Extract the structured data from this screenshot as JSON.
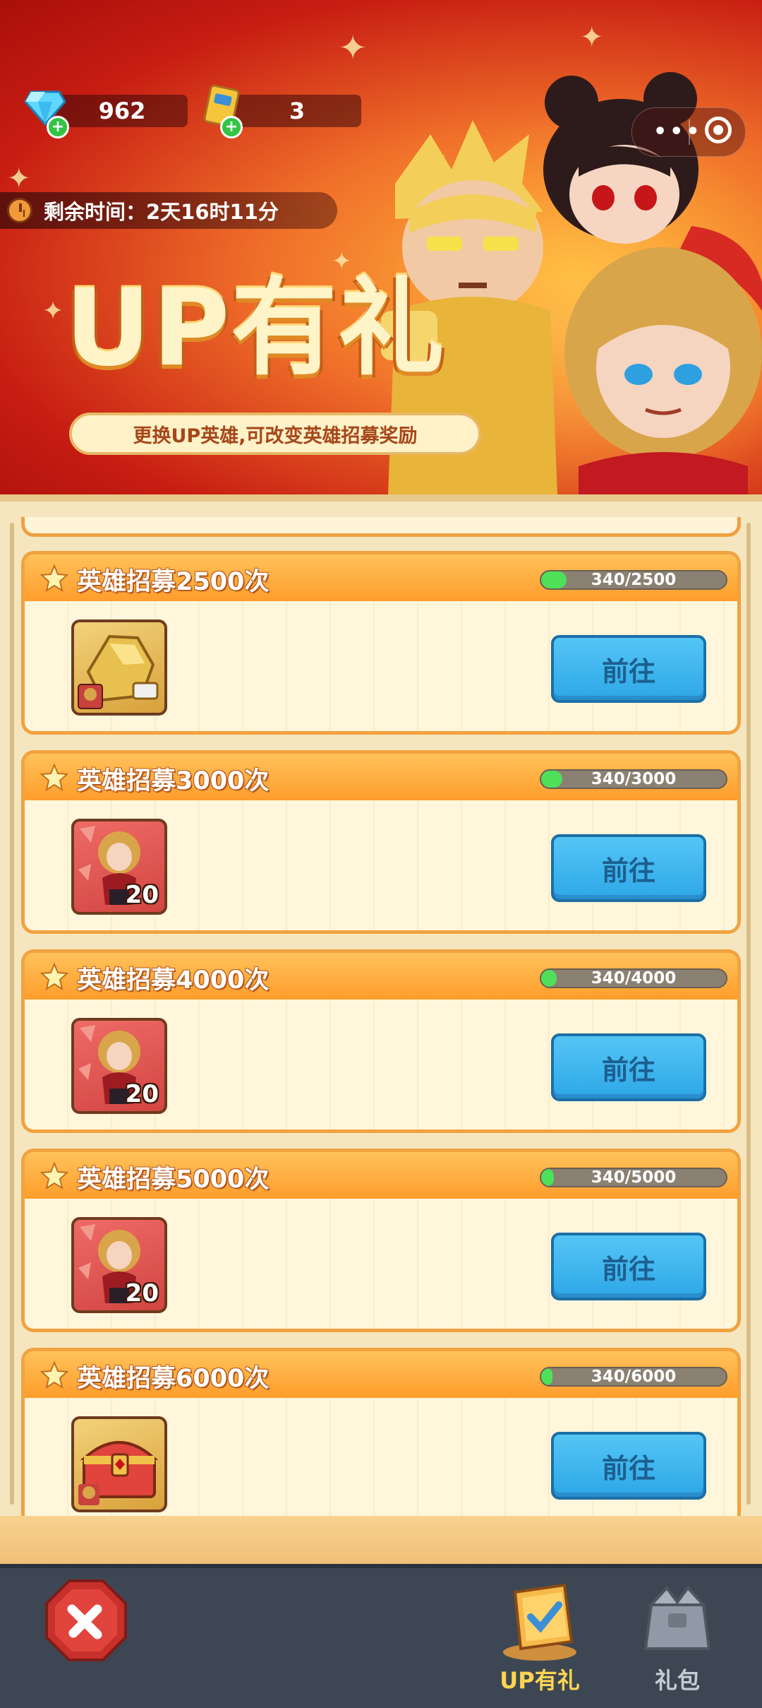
{
  "resources": {
    "diamonds": "962",
    "tickets": "3"
  },
  "timer": {
    "label": "剩余时间：2天16时11分"
  },
  "banner": {
    "title": "UP有礼",
    "subtitle": "更换UP英雄,可改变英雄招募奖励"
  },
  "colors": {
    "accent_orange": "#ff9d2c",
    "button_blue": "#2ea7e7",
    "progress_green": "#4fe05a",
    "banner_red": "#c71d12"
  },
  "tasks": [
    {
      "title": "英雄招募2500次",
      "progress_text": "340/2500",
      "progress": 0.136,
      "reward_icon": "gold-hero-shard-icon",
      "reward_count": "",
      "button": "前往"
    },
    {
      "title": "英雄招募3000次",
      "progress_text": "340/3000",
      "progress": 0.113,
      "reward_icon": "hero-fragment-icon",
      "reward_count": "20",
      "button": "前往"
    },
    {
      "title": "英雄招募4000次",
      "progress_text": "340/4000",
      "progress": 0.085,
      "reward_icon": "hero-fragment-icon",
      "reward_count": "20",
      "button": "前往"
    },
    {
      "title": "英雄招募5000次",
      "progress_text": "340/5000",
      "progress": 0.068,
      "reward_icon": "hero-fragment-icon",
      "reward_count": "20",
      "button": "前往"
    },
    {
      "title": "英雄招募6000次",
      "progress_text": "340/6000",
      "progress": 0.057,
      "reward_icon": "treasure-chest-icon",
      "reward_count": "",
      "button": "前往"
    }
  ],
  "nav": {
    "tab_up": "UP有礼",
    "tab_pack": "礼包",
    "active": "UP有礼"
  }
}
